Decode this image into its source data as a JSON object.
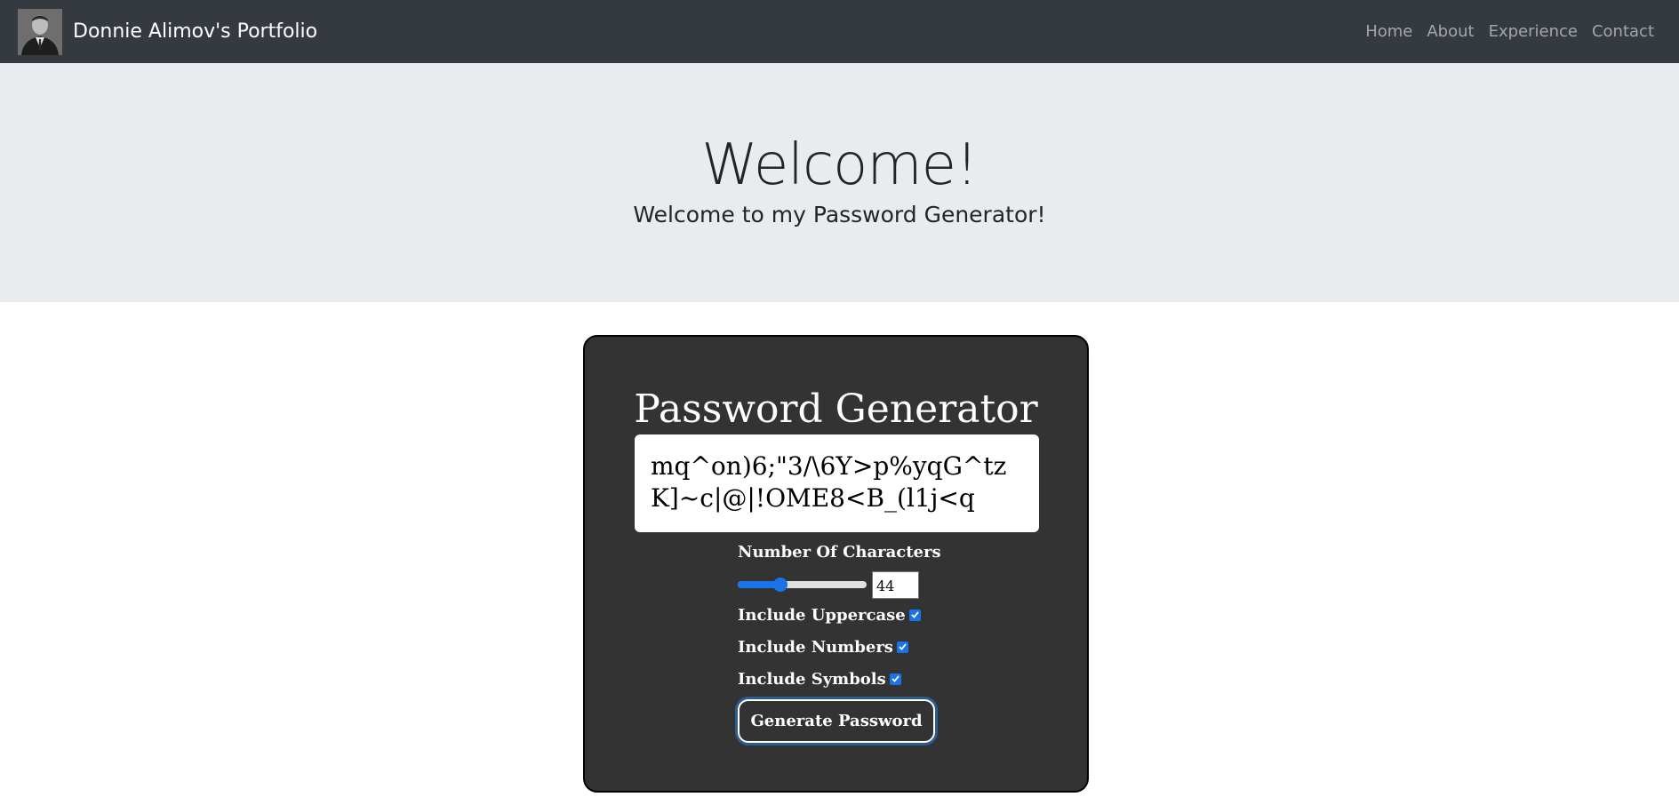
{
  "navbar": {
    "brand": "Donnie Alimov's Portfolio",
    "links": [
      "Home",
      "About",
      "Experience",
      "Contact"
    ]
  },
  "hero": {
    "title": "Welcome!",
    "subtitle": "Welcome to my Password Generator!"
  },
  "generator": {
    "title": "Password Generator",
    "password": "mq^on)6;\"3/\\6Y>p%yqG^tzK]~c|@|!OME8<B_(l1j<q",
    "chars_label": "Number Of Characters",
    "length": 44,
    "length_value": "44",
    "length_fraction": 0.33,
    "uppercase_label": "Include Uppercase",
    "uppercase_checked": true,
    "numbers_label": "Include Numbers",
    "numbers_checked": true,
    "symbols_label": "Include Symbols",
    "symbols_checked": true,
    "button_label": "Generate Password"
  },
  "colors": {
    "navbar": "#343a40",
    "hero": "#e9ecef",
    "card": "#333333",
    "accent": "#1a73e8"
  }
}
